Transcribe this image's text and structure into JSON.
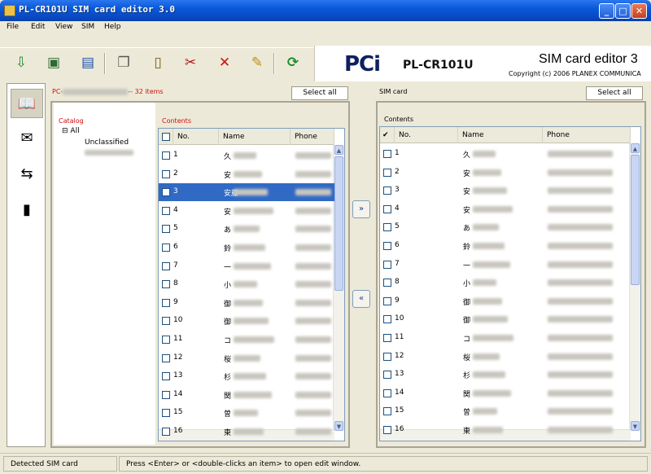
{
  "window": {
    "title": "PL-CR101U SIM card editor 3.0"
  },
  "menu": [
    "File",
    "Edit",
    "View",
    "SIM",
    "Help"
  ],
  "toolbar_icons": [
    "import-sim-icon",
    "computer-icon",
    "save-icon",
    "copy-icon",
    "paste-icon",
    "cut-icon",
    "delete-icon",
    "new-entry-icon",
    "refresh-icon"
  ],
  "brand": {
    "logo": "PCi",
    "model": "PL-CR101U",
    "product": "SIM card editor 3",
    "copyright": "Copyright (c) 2006 PLANEX COMMUNICA"
  },
  "left_pane": {
    "title_prefix": "PC-",
    "title_suffix": "-- 32 items",
    "select_all": "Select all",
    "catalog_label": "Catalog",
    "contents_label": "Contents",
    "tree": [
      "All",
      "Unclassified"
    ],
    "columns": [
      "No.",
      "Name",
      "Phone"
    ],
    "selected_row": 3,
    "rows": [
      {
        "no": "1",
        "name": "久"
      },
      {
        "no": "2",
        "name": "安"
      },
      {
        "no": "3",
        "name": "安藤"
      },
      {
        "no": "4",
        "name": "安"
      },
      {
        "no": "5",
        "name": "あ"
      },
      {
        "no": "6",
        "name": "鈴"
      },
      {
        "no": "7",
        "name": "一"
      },
      {
        "no": "8",
        "name": "小"
      },
      {
        "no": "9",
        "name": "御"
      },
      {
        "no": "10",
        "name": "御"
      },
      {
        "no": "11",
        "name": "コ"
      },
      {
        "no": "12",
        "name": "桜"
      },
      {
        "no": "13",
        "name": "杉"
      },
      {
        "no": "14",
        "name": "関"
      },
      {
        "no": "15",
        "name": "曽"
      },
      {
        "no": "16",
        "name": "東"
      }
    ]
  },
  "right_pane": {
    "title": "SIM card",
    "select_all": "Select all",
    "contents_label": "Contents",
    "columns": [
      "No.",
      "Name",
      "Phone"
    ],
    "rows": [
      {
        "no": "1",
        "name": "久"
      },
      {
        "no": "2",
        "name": "安"
      },
      {
        "no": "3",
        "name": "安"
      },
      {
        "no": "4",
        "name": "安"
      },
      {
        "no": "5",
        "name": "あ"
      },
      {
        "no": "6",
        "name": "鈴"
      },
      {
        "no": "7",
        "name": "一"
      },
      {
        "no": "8",
        "name": "小"
      },
      {
        "no": "9",
        "name": "御"
      },
      {
        "no": "10",
        "name": "御"
      },
      {
        "no": "11",
        "name": "コ"
      },
      {
        "no": "12",
        "name": "桜"
      },
      {
        "no": "13",
        "name": "杉"
      },
      {
        "no": "14",
        "name": "関"
      },
      {
        "no": "15",
        "name": "曽"
      },
      {
        "no": "16",
        "name": "東"
      }
    ]
  },
  "transfer": {
    "to_sim": "»",
    "to_pc": "«"
  },
  "status": {
    "left": "Detected SIM card",
    "right": "Press <Enter> or <double-clicks an item> to open edit window."
  }
}
